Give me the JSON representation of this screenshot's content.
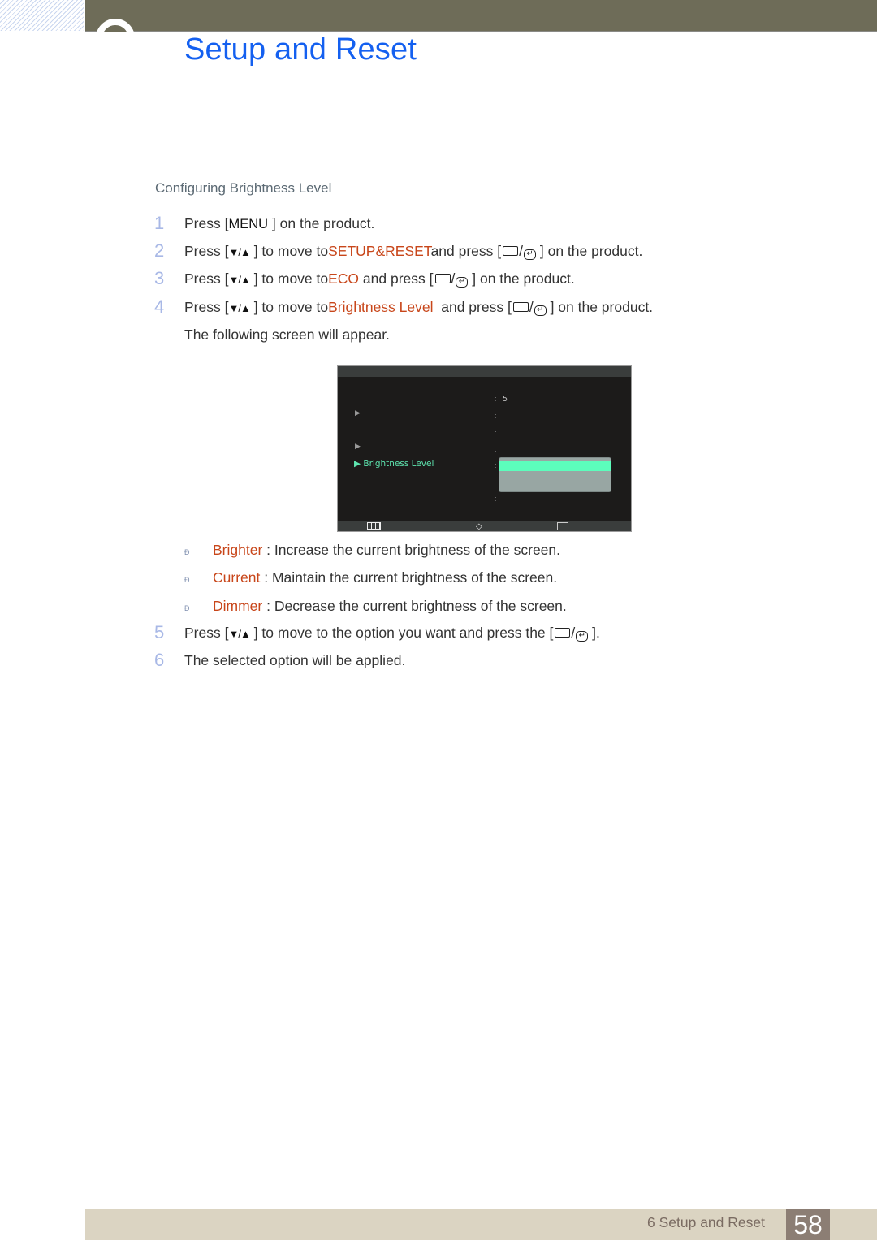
{
  "header": {
    "title": "Setup and Reset",
    "colors": {
      "bar": "#6e6c58",
      "title": "#1460f0"
    }
  },
  "section": {
    "title": "Configuring Brightness Level"
  },
  "steps": [
    {
      "num": "1",
      "pre": "Press [",
      "key": "MENU",
      "post": " ] on the product."
    },
    {
      "num": "2",
      "pre": "Press [",
      "arrows": "▼/▲",
      "mid": " ] to move to",
      "highlight": "SETUP&RESET",
      "mid2": "and press [",
      "post": " ] on the product."
    },
    {
      "num": "3",
      "pre": "Press [",
      "arrows": "▼/▲",
      "mid": " ] to move to",
      "highlight": "ECO",
      "mid2": " and press [",
      "post": " ] on the product."
    },
    {
      "num": "4",
      "pre": "Press [",
      "arrows": "▼/▲",
      "mid": " ] to move to",
      "highlight": "Brightness Level",
      "mid2": "  and press [",
      "post": " ] on the product."
    },
    {
      "num": "5",
      "pre": "Press [",
      "arrows": "▼/▲",
      "mid": " ] to move to the option you want and press the [",
      "post": " ]."
    },
    {
      "num": "6",
      "text": "The selected option will be applied."
    }
  ],
  "following_text": "The following screen will appear.",
  "osd": {
    "selected_item": "▶ Brightness Level",
    "arrow_glyph": "▶",
    "value": "5",
    "colon": ":",
    "colors": {
      "highlight": "#5cfdbc",
      "popup": "#98a6a3",
      "selected_text": "#5ee6b0"
    },
    "footer_icons": [
      "menu-icon",
      "up-down-icon",
      "enter-icon"
    ],
    "updown_glyph": "◇"
  },
  "options": [
    {
      "bullet": "Ð",
      "name": "Brighter",
      "desc": " : Increase the current brightness of the screen."
    },
    {
      "bullet": "Ð",
      "name": "Current",
      "desc": " : Maintain the current brightness of the screen."
    },
    {
      "bullet": "Ð",
      "name": "Dimmer",
      "desc": " : Decrease the current brightness of the screen."
    }
  ],
  "footer": {
    "chapter_label": "6 Setup and Reset",
    "page_number": "58"
  }
}
